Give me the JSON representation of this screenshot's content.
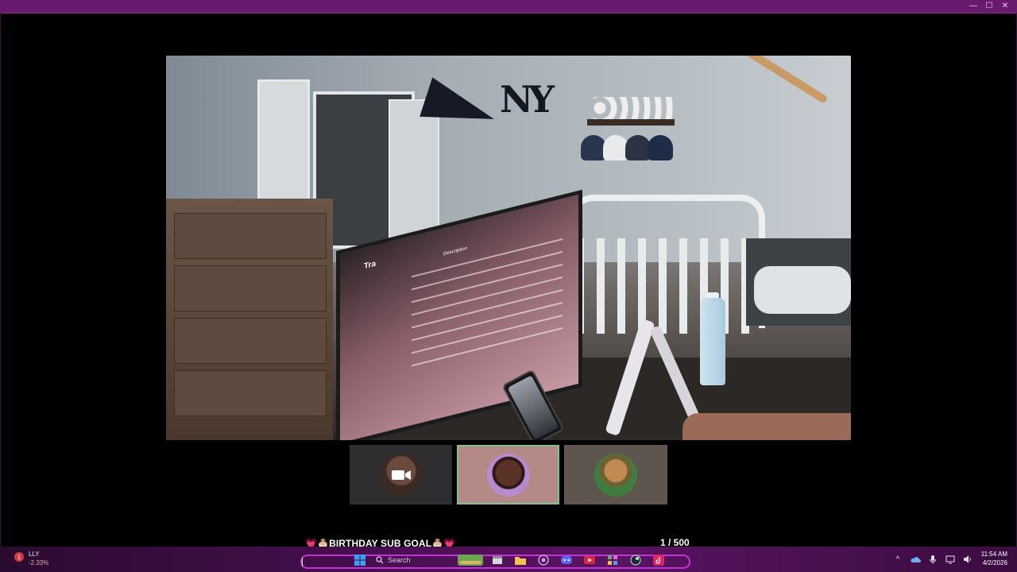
{
  "window": {
    "controls": {
      "minimize": "—",
      "maximize": "☐",
      "close": "✕"
    }
  },
  "stream": {
    "main_feed_icon": "webcam-room-view",
    "monitor_screen_title": "Tra",
    "monitor_screen_header": "Description",
    "participants": [
      {
        "name": "camera-off-participant",
        "avatar_icon": "video-camera-icon",
        "selected": false
      },
      {
        "name": "participant-2",
        "avatar_icon": "avatar-portrait",
        "selected": true
      },
      {
        "name": "participant-3",
        "avatar_icon": "avatar-money-portrait",
        "selected": false
      }
    ]
  },
  "goal": {
    "label": "💗🎂BIRTHDAY SUB GOAL🎂💗",
    "count": "1 / 500"
  },
  "taskbar": {
    "weather": {
      "ticker": "LLY",
      "change": "-2.33%",
      "badge": "1"
    },
    "search_placeholder": "Search",
    "apps": [
      "windows-start-icon",
      "search-icon",
      "widget-game-icon",
      "file-explorer-icon",
      "folder-icon",
      "browser-icon",
      "discord-icon",
      "youtube-icon",
      "app-grid-icon",
      "steam-icon",
      "tiktok-icon"
    ],
    "tray": {
      "chevron": "^",
      "clock_time": "11:54 AM",
      "clock_date": "4/2/2026"
    }
  },
  "colors": {
    "titlebar": "#6a1a6e",
    "pill_border": "#c531d8",
    "selected_thumb_outline": "#7bc58a"
  }
}
